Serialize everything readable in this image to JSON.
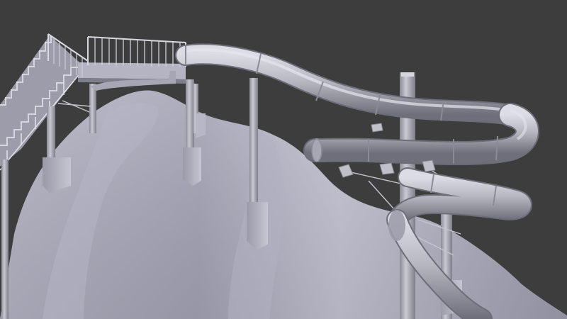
{
  "viewport": {
    "background": "#3d3d3d",
    "shading": "solid-clay",
    "subject": "water-slide-model"
  },
  "colors": {
    "clay_light": "#c9c9d6",
    "clay_mid": "#a9a9b8",
    "clay_dark": "#7f7f8e",
    "clay_shadow": "#5f5f6c",
    "tube_light": "#bfbfca",
    "tube_dark": "#7a7a86",
    "rail": "#d2d2dc"
  }
}
